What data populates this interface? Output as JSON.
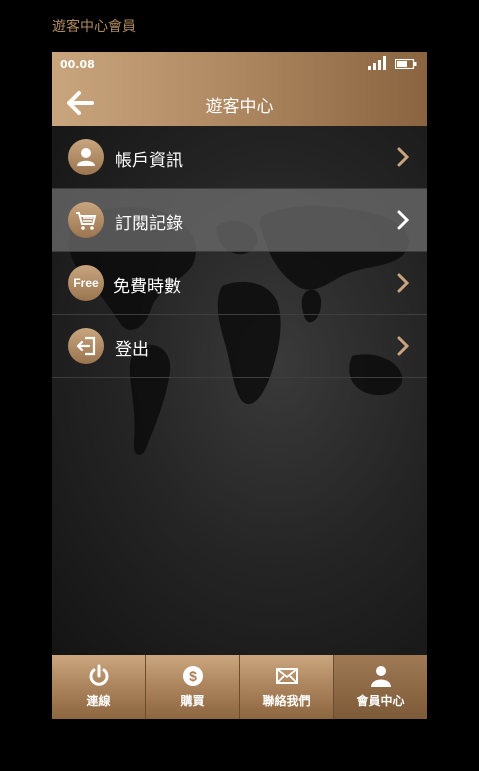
{
  "page_caption": "遊客中心會員",
  "status_bar": {
    "time": "00.08"
  },
  "header": {
    "title": "遊客中心"
  },
  "menu": {
    "items": [
      {
        "label": "帳戶資訊",
        "icon": "user-icon"
      },
      {
        "label": "訂閱記錄",
        "icon": "cart-icon"
      },
      {
        "label": "免費時數",
        "icon": "free-badge-icon",
        "badge_text": "Free"
      },
      {
        "label": "登出",
        "icon": "logout-icon"
      }
    ],
    "active_index": 1
  },
  "tabbar": {
    "tabs": [
      {
        "label": "連線",
        "icon": "power-icon"
      },
      {
        "label": "購買",
        "icon": "dollar-icon"
      },
      {
        "label": "聯絡我們",
        "icon": "mail-icon"
      },
      {
        "label": "會員中心",
        "icon": "member-icon"
      }
    ],
    "active_index": 3
  },
  "colors": {
    "accent_gold": "#c9a57e",
    "accent_dark": "#8a6440",
    "caption": "#b08a5e"
  }
}
